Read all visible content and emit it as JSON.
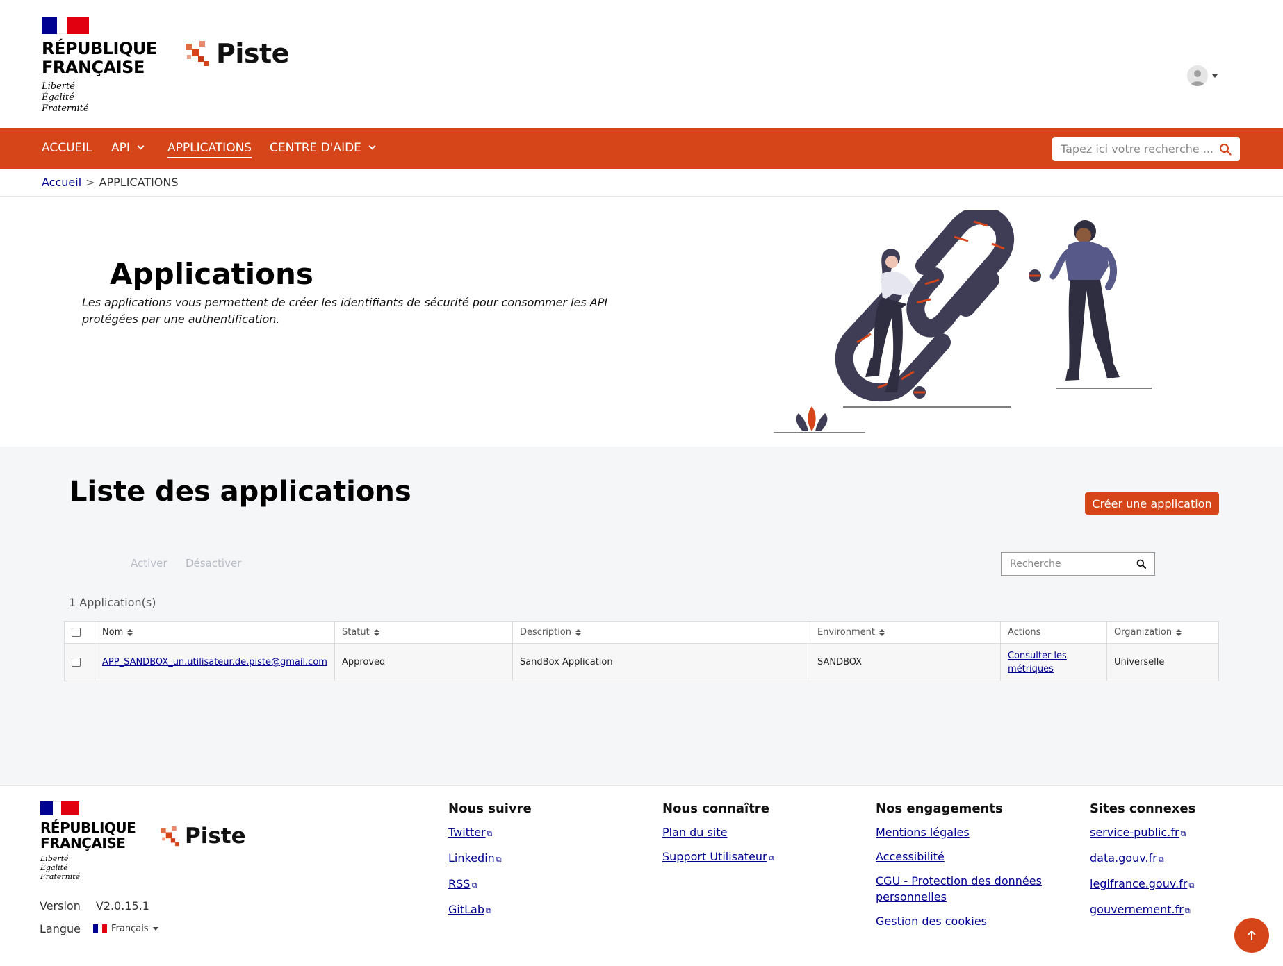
{
  "header": {
    "republic_name": "RÉPUBLIQUE\nFRANÇAISE",
    "motto": "Liberté\nÉgalité\nFraternité",
    "brand": "Piste",
    "colors": {
      "primary": "#d64519",
      "blue": "#000091",
      "red": "#e1000f"
    }
  },
  "nav": {
    "items": [
      {
        "label": "ACCUEIL"
      },
      {
        "label": "API"
      },
      {
        "label": "APPLICATIONS"
      },
      {
        "label": "CENTRE D'AIDE"
      }
    ],
    "search_placeholder": "Tapez ici votre recherche ...",
    "icons": {
      "search": "search-icon"
    }
  },
  "breadcrumb": {
    "home": "Accueil",
    "separator": ">",
    "current": "APPLICATIONS"
  },
  "hero": {
    "title": "Applications",
    "description": "Les applications vous permettent de créer les identifiants de sécurité pour consommer les API protégées par une authentification."
  },
  "main": {
    "title": "Liste des applications",
    "create_button": "Créer une application",
    "activate": "Activer",
    "deactivate": "Désactiver",
    "search_placeholder": "Recherche",
    "count": "1 Application(s)",
    "columns": [
      "Nom",
      "Statut",
      "Description",
      "Environment",
      "Actions",
      "Organization"
    ],
    "rows": [
      {
        "name": "APP_SANDBOX_un.utilisateur.de.piste@gmail.com",
        "status": "Approved",
        "description": "SandBox Application",
        "environment": "SANDBOX",
        "action": "Consulter les métriques",
        "organization": "Universelle"
      }
    ]
  },
  "footer": {
    "republic_name": "RÉPUBLIQUE\nFRANÇAISE",
    "motto": "Liberté\nÉgalité\nFraternité",
    "brand": "Piste",
    "version_label": "Version",
    "version_value": "V2.0.15.1",
    "language_label": "Langue",
    "language_value": "Français",
    "columns": [
      {
        "title": "Nous suivre",
        "links": [
          "Twitter",
          "Linkedin",
          "RSS",
          "GitLab"
        ]
      },
      {
        "title": "Nous connaître",
        "links": [
          "Plan du site",
          "Support Utilisateur"
        ]
      },
      {
        "title": "Nos engagements",
        "links": [
          "Mentions légales",
          "Accessibilité",
          "CGU - Protection des données personnelles",
          "Gestion des cookies"
        ]
      },
      {
        "title": "Sites connexes",
        "links": [
          "service-public.fr",
          "data.gouv.fr",
          "legifrance.gouv.fr",
          "gouvernement.fr"
        ]
      }
    ]
  }
}
